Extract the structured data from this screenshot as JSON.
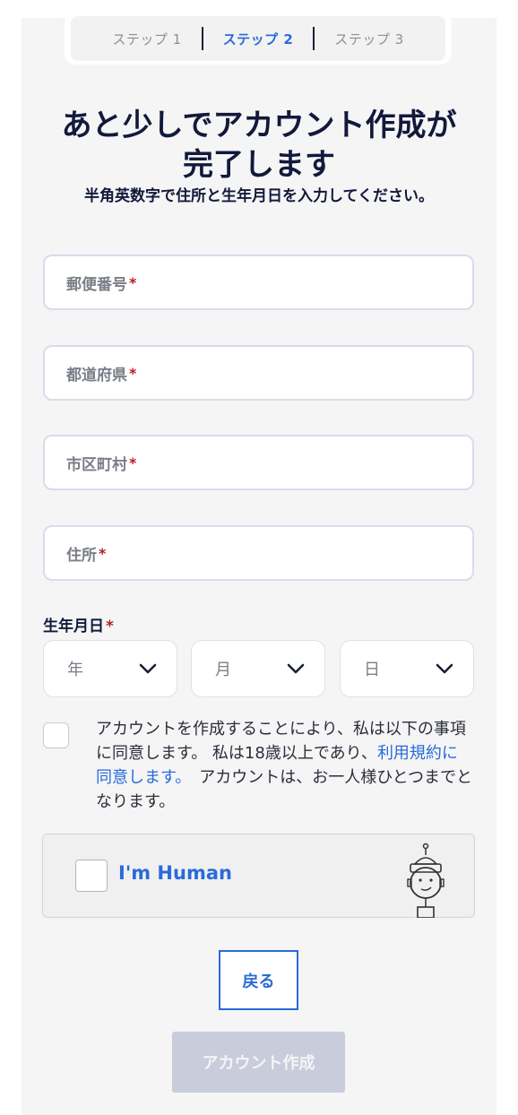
{
  "steps": [
    {
      "label": "ステップ 1",
      "active": false
    },
    {
      "label": "ステップ 2",
      "active": true
    },
    {
      "label": "ステップ 3",
      "active": false
    }
  ],
  "header": {
    "title_line1": "あと少しでアカウント作成が",
    "title_line2": "完了します",
    "subtitle": "半角英数字で住所と生年月日を入力してください。"
  },
  "form": {
    "postal_code": {
      "placeholder": "郵便番号",
      "required": "*"
    },
    "prefecture": {
      "placeholder": "都道府県",
      "required": "*"
    },
    "city": {
      "placeholder": "市区町村",
      "required": "*"
    },
    "address": {
      "placeholder": "住所",
      "required": "*"
    },
    "dob": {
      "label": "生年月日",
      "required": "*",
      "year": "年",
      "month": "月",
      "day": "日"
    }
  },
  "agreement": {
    "text_before": "アカウントを作成することにより、私は以下の事項に同意します。 私は18歳以上であり、",
    "link": "利用規約に同意します。",
    "text_after": "　アカウントは、お一人様ひとつまでとなります。"
  },
  "captcha": {
    "label": "I'm Human"
  },
  "buttons": {
    "back": "戻る",
    "create": "アカウント作成"
  },
  "colors": {
    "accent": "#2a6bd8",
    "required": "#b51f1f",
    "disabled": "#c9ccda"
  }
}
